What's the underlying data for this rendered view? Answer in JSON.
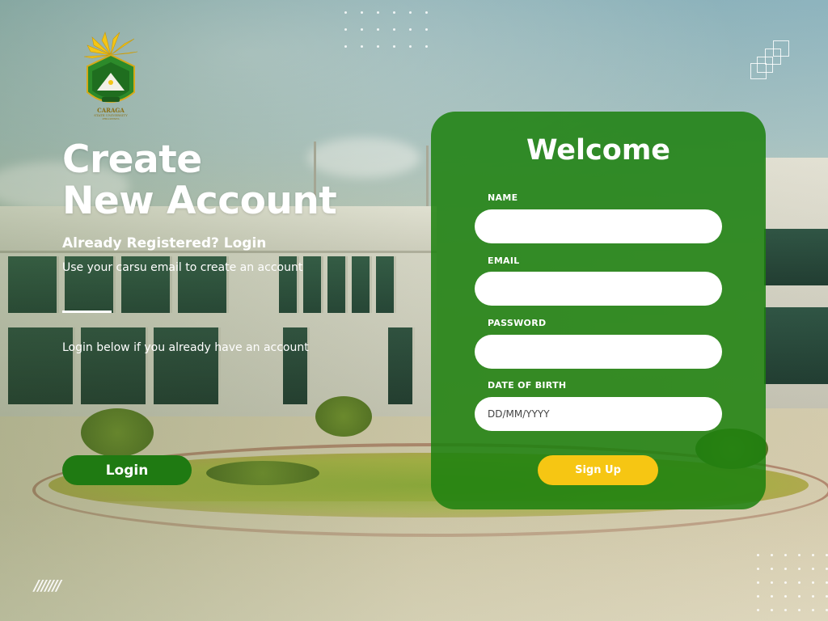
{
  "brand": {
    "logo_icon": "university-seal-icon",
    "logo_caption": {
      "line1": "CARAGA",
      "line2": "STATE UNIVERSITY",
      "line3": "PHILIPPINES"
    },
    "colors": {
      "primary_green": "#1c800e",
      "accent_yellow": "#f6c613",
      "text_white": "#ffffff"
    }
  },
  "hero": {
    "title_line1": "Create",
    "title_line2": "New Account",
    "already_registered": "Already Registered? Login",
    "subtext": "Use your carsu email to create an account",
    "login_hint": "Login below if you already have an account",
    "login_button": "Login"
  },
  "form": {
    "title": "Welcome",
    "fields": [
      {
        "label": "NAME",
        "value": "",
        "placeholder": ""
      },
      {
        "label": "EMAIL",
        "value": "",
        "placeholder": ""
      },
      {
        "label": "PASSWORD",
        "value": "",
        "placeholder": ""
      },
      {
        "label": "DATE OF BIRTH",
        "value": "",
        "placeholder": "DD/MM/YYYY"
      }
    ],
    "submit_button": "Sign Up"
  }
}
